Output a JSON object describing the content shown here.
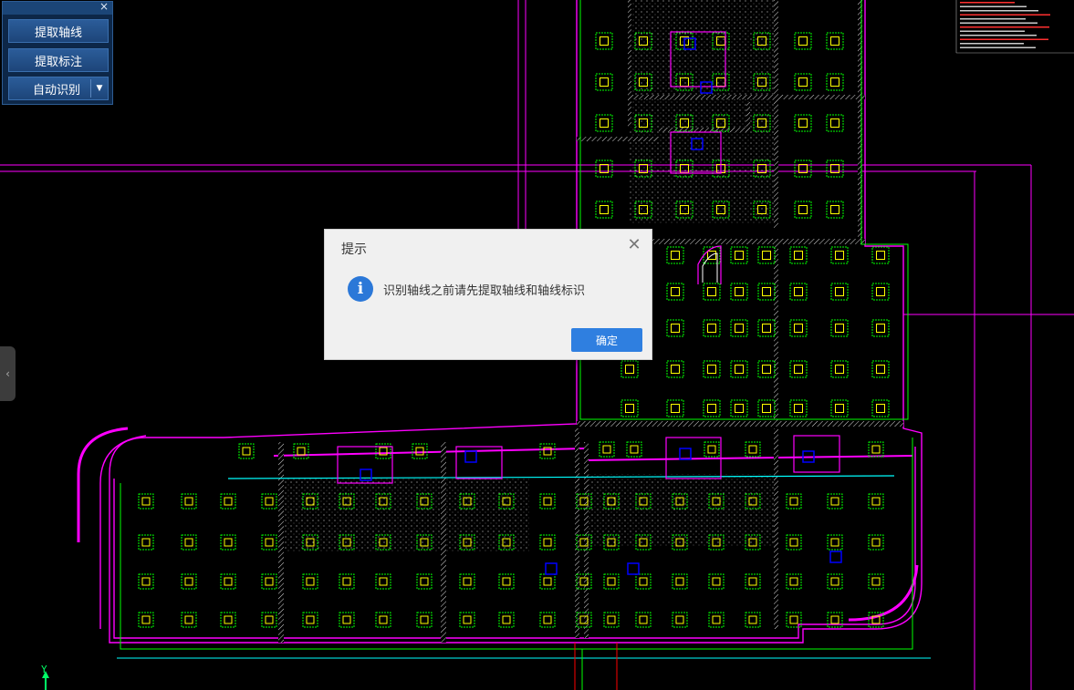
{
  "tool_panel": {
    "close_glyph": "×",
    "buttons": [
      {
        "label": "提取轴线"
      },
      {
        "label": "提取标注"
      },
      {
        "label": "自动识别",
        "has_dropdown": true
      }
    ],
    "dropdown_glyph": "▼"
  },
  "side_handle": {
    "glyph": "‹"
  },
  "dialog": {
    "title": "提示",
    "close_glyph": "✕",
    "icon": "info-icon",
    "icon_glyph": "i",
    "message": "识别轴线之前请先提取轴线和轴线标识",
    "ok_label": "确定"
  },
  "ucs": {
    "y_label": "Y"
  },
  "colors": {
    "canvas_bg": "#000000",
    "wall": "#ff00ff",
    "column": "#ffff00",
    "rebar": "#00ff00",
    "hatch": "#ffffff",
    "cyan": "#00ffff",
    "blue": "#0000ff",
    "red": "#ff0000",
    "accent": "#2f7fe0"
  }
}
